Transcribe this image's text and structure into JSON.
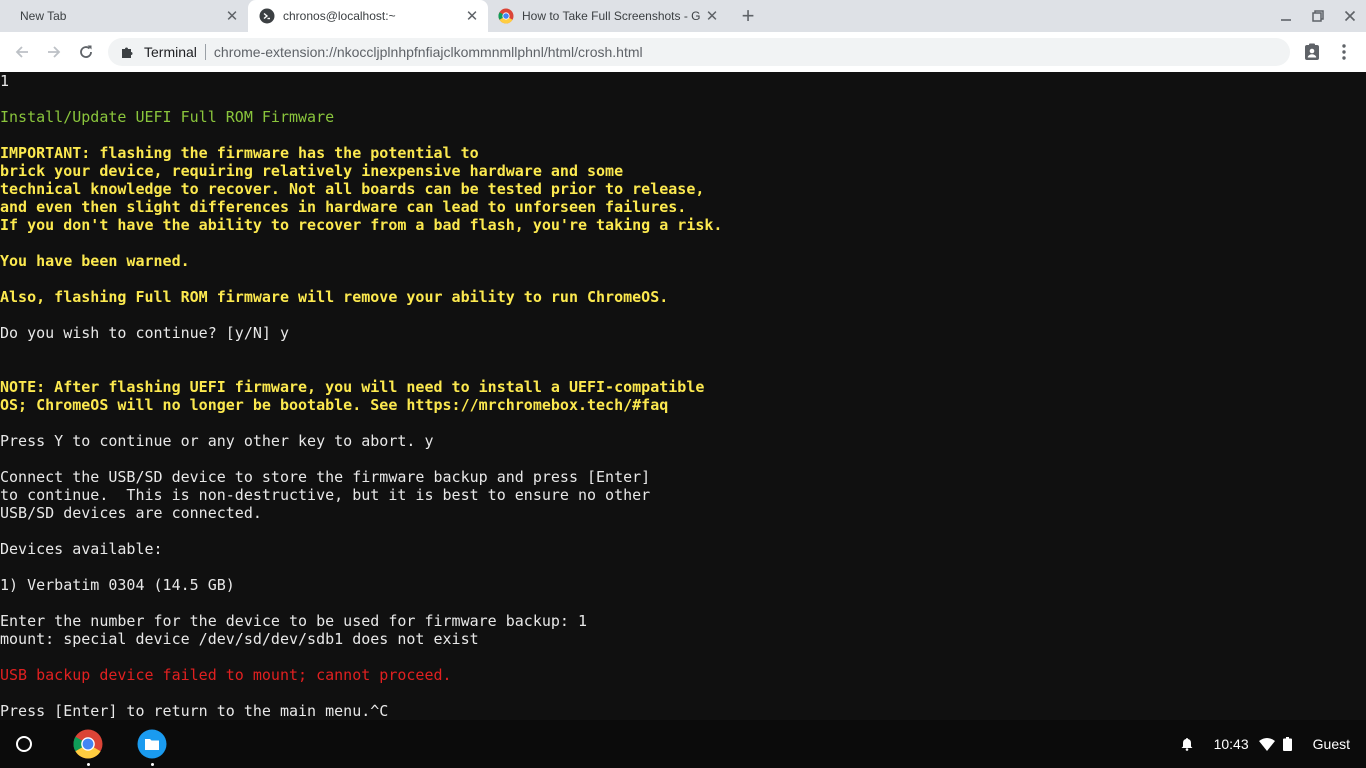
{
  "tabs": [
    {
      "title": "New Tab",
      "active": false
    },
    {
      "title": "chronos@localhost:~",
      "active": true
    },
    {
      "title": "How to Take Full Screenshots - G",
      "active": false
    }
  ],
  "toolbar": {
    "extension_name": "Terminal",
    "url": "chrome-extension://nkoccljplnhpfnfiajclkommnmllphnl/html/crosh.html"
  },
  "terminal": {
    "lines": [
      {
        "text": "1",
        "color": "white"
      },
      {
        "text": "",
        "color": "white"
      },
      {
        "text": "Install/Update UEFI Full ROM Firmware",
        "color": "green"
      },
      {
        "text": "",
        "color": "white"
      },
      {
        "text": "IMPORTANT: flashing the firmware has the potential to",
        "color": "yellow"
      },
      {
        "text": "brick your device, requiring relatively inexpensive hardware and some",
        "color": "yellow"
      },
      {
        "text": "technical knowledge to recover. Not all boards can be tested prior to release,",
        "color": "yellow"
      },
      {
        "text": "and even then slight differences in hardware can lead to unforseen failures.",
        "color": "yellow"
      },
      {
        "text": "If you don't have the ability to recover from a bad flash, you're taking a risk.",
        "color": "yellow"
      },
      {
        "text": "",
        "color": "white"
      },
      {
        "text": "You have been warned.",
        "color": "yellow"
      },
      {
        "text": "",
        "color": "white"
      },
      {
        "text": "Also, flashing Full ROM firmware will remove your ability to run ChromeOS.",
        "color": "yellow"
      },
      {
        "text": "",
        "color": "white"
      },
      {
        "text": "Do you wish to continue? [y/N] y",
        "color": "white"
      },
      {
        "text": "",
        "color": "white"
      },
      {
        "text": "",
        "color": "white"
      },
      {
        "text": "NOTE: After flashing UEFI firmware, you will need to install a UEFI-compatible",
        "color": "yellow"
      },
      {
        "text": "OS; ChromeOS will no longer be bootable. See https://mrchromebox.tech/#faq",
        "color": "yellow"
      },
      {
        "text": "",
        "color": "white"
      },
      {
        "text": "Press Y to continue or any other key to abort. y",
        "color": "white"
      },
      {
        "text": "",
        "color": "white"
      },
      {
        "text": "Connect the USB/SD device to store the firmware backup and press [Enter]",
        "color": "white"
      },
      {
        "text": "to continue.  This is non-destructive, but it is best to ensure no other",
        "color": "white"
      },
      {
        "text": "USB/SD devices are connected.",
        "color": "white"
      },
      {
        "text": "",
        "color": "white"
      },
      {
        "text": "Devices available:",
        "color": "white"
      },
      {
        "text": "",
        "color": "white"
      },
      {
        "text": "1) Verbatim 0304 (14.5 GB)",
        "color": "white"
      },
      {
        "text": "",
        "color": "white"
      },
      {
        "text": "Enter the number for the device to be used for firmware backup: 1",
        "color": "white"
      },
      {
        "text": "mount: special device /dev/sd/dev/sdb1 does not exist",
        "color": "white"
      },
      {
        "text": "",
        "color": "white"
      },
      {
        "text": "USB backup device failed to mount; cannot proceed.",
        "color": "red"
      },
      {
        "text": "",
        "color": "white"
      },
      {
        "text": "Press [Enter] to return to the main menu.^C",
        "color": "white"
      }
    ]
  },
  "shelf": {
    "apps": [
      {
        "name": "chrome-app-icon"
      },
      {
        "name": "files-app-icon"
      }
    ],
    "time": "10:43",
    "user": "Guest"
  },
  "colors": {
    "terminal_bg": "#101010",
    "terminal_text": "#e8e8e8",
    "heading_green": "#8ac53c",
    "warning_yellow": "#fce94f",
    "error_red": "#e02020"
  }
}
